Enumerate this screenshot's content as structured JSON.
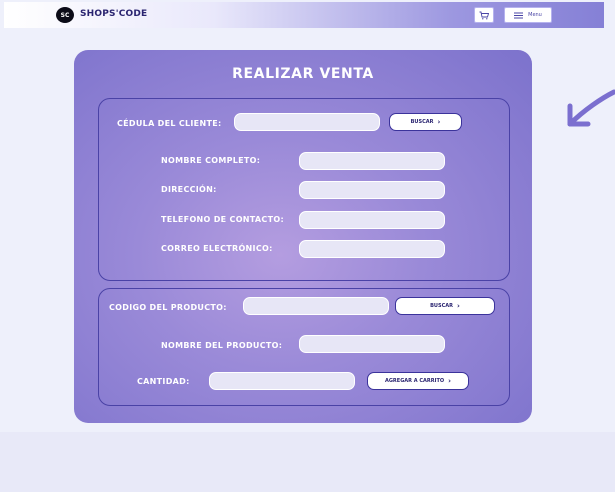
{
  "navbar": {
    "logo_badge": "SC",
    "brand": "SHOPS'CODE",
    "cart_icon": "cart-icon",
    "menu_label": "Menu",
    "menu_icon": "hamburger-icon"
  },
  "form": {
    "title": "REALIZAR VENTA",
    "client": {
      "id_label": "CÉDULA DEL CLIENTE:",
      "id_value": "",
      "search_button": "BUSCAR",
      "name_label": "NOMBRE COMPLETO:",
      "name_value": "",
      "address_label": "DIRECCIÓN:",
      "address_value": "",
      "phone_label": "TELEFONO DE CONTACTO:",
      "phone_value": "",
      "email_label": "CORREO ELECTRÓNICO:",
      "email_value": ""
    },
    "product": {
      "code_label": "CODIGO DEL PRODUCTO:",
      "code_value": "",
      "search_button": "BUSCAR",
      "name_label": "NOMBRE DEL PRODUCTO:",
      "name_value": "",
      "quantity_label": "CANTIDAD:",
      "quantity_value": "",
      "add_button": "AGREGAR A CARRITO"
    }
  },
  "colors": {
    "card": "#9a8ad8",
    "section_border": "#4a42a6",
    "button_border": "#3b339b",
    "field_bg": "#e7e6f6",
    "arrow": "#7b6fcf"
  },
  "icons": [
    "cart-icon",
    "hamburger-icon",
    "chevron-right-icon",
    "decorative-arrow-icon"
  ]
}
